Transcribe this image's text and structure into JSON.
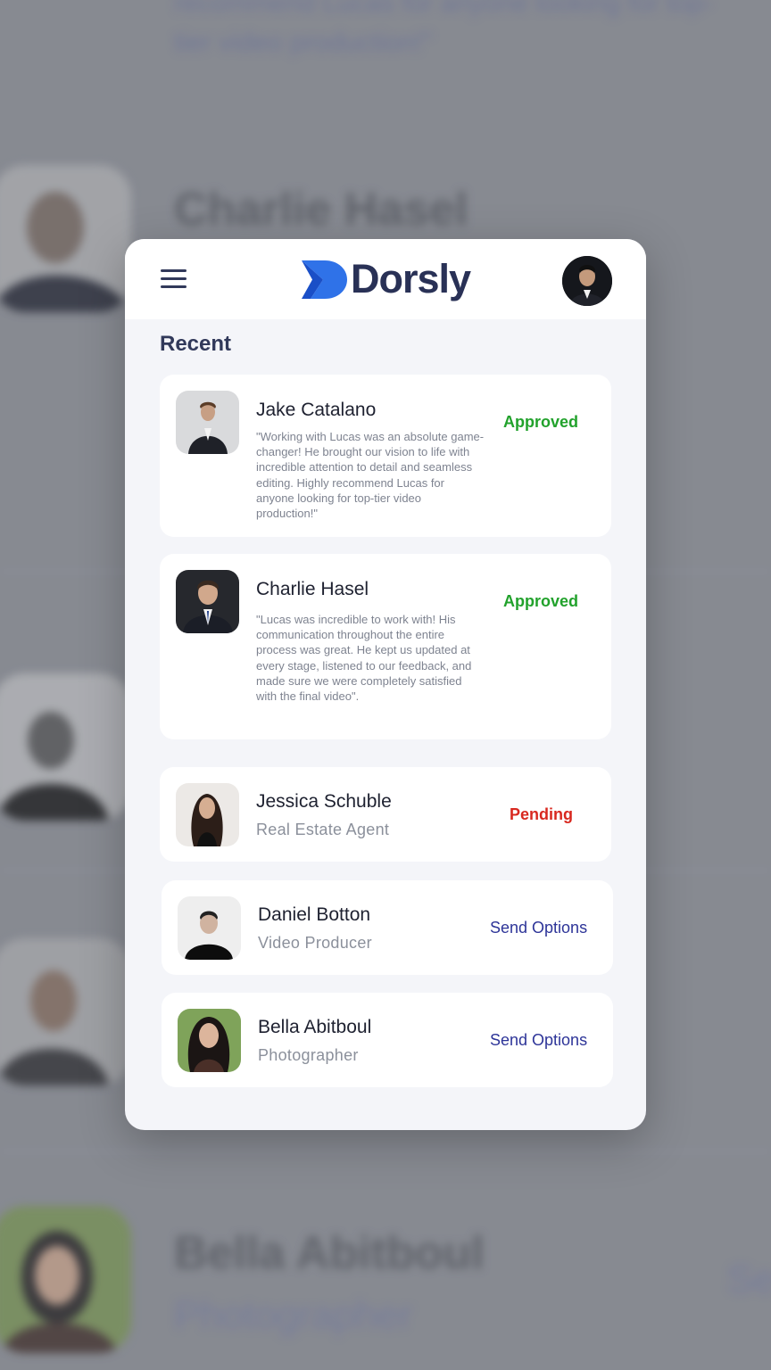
{
  "background": {
    "quote": "recommend Lucas for anyone looking for top-tier video production!\"",
    "names": [
      "Charlie Hasel",
      "Bella Abitboul"
    ],
    "role": "Photographer",
    "right_fragment": "Se"
  },
  "header": {
    "brand": "Dorsly",
    "brand_color": "#293156",
    "logo_color": "#2f72e8"
  },
  "section_title": "Recent",
  "items": [
    {
      "name": "Jake Catalano",
      "quote": "\"Working with Lucas was an absolute game-changer! He brought our vision to life with incredible attention to detail and seamless editing. Highly recommend Lucas for anyone looking for top-tier video production!\"",
      "status": "Approved",
      "status_color": "#22a22c"
    },
    {
      "name": "Charlie Hasel",
      "quote": "\"Lucas was incredible to work with! His communication throughout the entire process was great. He kept us updated at every stage, listened to our feedback, and made sure we were completely satisfied with the final video\".",
      "status": "Approved",
      "status_color": "#22a22c"
    },
    {
      "name": "Jessica Schuble",
      "role": "Real Estate Agent",
      "status": "Pending",
      "status_color": "#d8281f"
    },
    {
      "name": "Daniel Botton",
      "role": "Video Producer",
      "status": "Send Options",
      "status_color": "#2d3498"
    },
    {
      "name": "Bella Abitboul",
      "role": "Photographer",
      "status": "Send Options",
      "status_color": "#2d3498"
    }
  ]
}
